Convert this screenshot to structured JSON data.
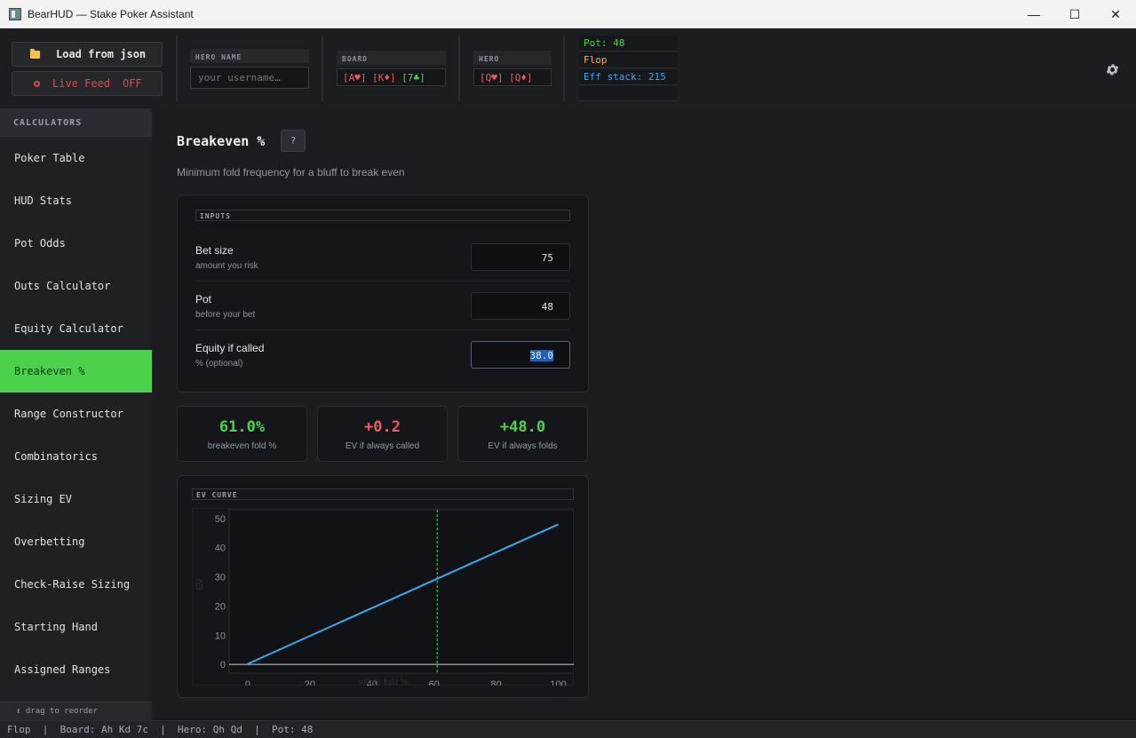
{
  "window": {
    "title": "BearHUD — Stake Poker Assistant",
    "minimize": "—",
    "maximize": "☐",
    "close": "✕"
  },
  "header": {
    "load_button": "Load from json",
    "live_feed_label": "Live Feed",
    "live_feed_state": "OFF",
    "hero_name_label": "HERO NAME",
    "hero_name_placeholder": "your username…",
    "board_label": "BOARD",
    "board_cards": [
      {
        "text": "[A♥]",
        "color": "red"
      },
      {
        "text": "[K♦]",
        "color": "red"
      },
      {
        "text": "[7♣]",
        "color": "green"
      }
    ],
    "hero_label": "HERO",
    "hero_cards": [
      {
        "text": "[Q♥]",
        "color": "red"
      },
      {
        "text": "[Q♦]",
        "color": "red"
      }
    ],
    "pot_text": "Pot: 48",
    "street_text": "Flop",
    "eff_stack_text": "Eff stack: 215"
  },
  "sidebar": {
    "heading": "CALCULATORS",
    "items": [
      {
        "label": "Poker Table"
      },
      {
        "label": "HUD Stats"
      },
      {
        "label": "Pot Odds"
      },
      {
        "label": "Outs Calculator"
      },
      {
        "label": "Equity Calculator"
      },
      {
        "label": "Breakeven %",
        "active": true
      },
      {
        "label": "Range Constructor"
      },
      {
        "label": "Combinatorics"
      },
      {
        "label": "Sizing EV"
      },
      {
        "label": "Overbetting"
      },
      {
        "label": "Check-Raise Sizing"
      },
      {
        "label": "Starting Hand"
      },
      {
        "label": "Assigned Ranges"
      }
    ],
    "footer": "↕ drag to reorder"
  },
  "main": {
    "title": "Breakeven %",
    "help_label": "?",
    "subtitle": "Minimum fold frequency for a bluff to break even",
    "inputs_label": "INPUTS",
    "inputs": [
      {
        "label": "Bet size",
        "sub": "amount you risk",
        "value": "75"
      },
      {
        "label": "Pot",
        "sub": "before your bet",
        "value": "48"
      },
      {
        "label": "Equity if called",
        "sub": "% (optional)",
        "value": "38.0"
      }
    ],
    "stats": [
      {
        "value": "61.0%",
        "label": "breakeven fold %",
        "color": "#4bd34b"
      },
      {
        "value": "+0.2",
        "label": "EV if always called",
        "color": "#f05a5a"
      },
      {
        "value": "+48.0",
        "label": "EV if always folds",
        "color": "#4bd34b"
      }
    ],
    "ev_curve_label": "EV CURVE"
  },
  "chart_data": {
    "type": "line",
    "title": "",
    "xlabel": "villain fold %",
    "ylabel": "EV",
    "xlim": [
      -6,
      105
    ],
    "ylim": [
      -3,
      53
    ],
    "xticks": [
      0,
      20,
      40,
      60,
      80,
      100
    ],
    "yticks": [
      0,
      10,
      20,
      30,
      40,
      50
    ],
    "series": [
      {
        "x": [
          0,
          100
        ],
        "y": [
          0.2,
          48.0
        ],
        "color": "#3aa9f0"
      }
    ],
    "breakeven_x": 61.0,
    "breakeven_color": "#4bd34b"
  },
  "statusbar": {
    "text": "Flop  |  Board: Ah Kd 7c  |  Hero: Qh Qd  |  Pot: 48"
  }
}
